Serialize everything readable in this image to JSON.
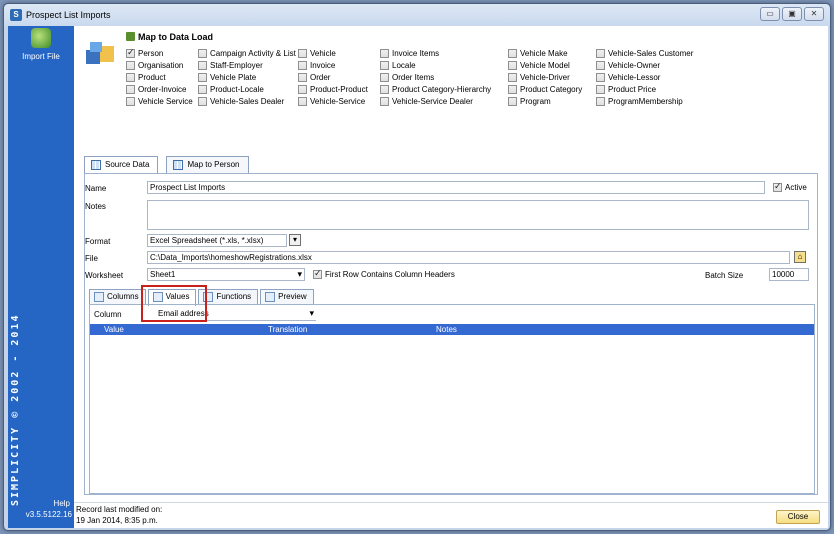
{
  "window": {
    "title": "Prospect List Imports",
    "app_letter": "S"
  },
  "sidebar": {
    "import_label": "Import File",
    "brand": "SIMPLICITY © 2002 - 2014",
    "help": "Help",
    "version": "v3.5.5122.16"
  },
  "map_to_data_load": {
    "heading": "Map to Data Load",
    "entities": [
      {
        "label": "Person",
        "checked": true
      },
      {
        "label": "Organisation",
        "checked": false
      },
      {
        "label": "Product",
        "checked": false
      },
      {
        "label": "Order-Invoice",
        "checked": false
      },
      {
        "label": "Vehicle Service",
        "checked": false
      },
      {
        "label": "Campaign Activity & List",
        "checked": false
      },
      {
        "label": "Staff-Employer",
        "checked": false
      },
      {
        "label": "Vehicle Plate",
        "checked": false
      },
      {
        "label": "Product-Locale",
        "checked": false
      },
      {
        "label": "Vehicle-Sales Dealer",
        "checked": false
      },
      {
        "label": "Vehicle",
        "checked": false
      },
      {
        "label": "Invoice",
        "checked": false
      },
      {
        "label": "Order",
        "checked": false
      },
      {
        "label": "Product-Product",
        "checked": false
      },
      {
        "label": "Vehicle-Service",
        "checked": false
      },
      {
        "label": "Invoice Items",
        "checked": false
      },
      {
        "label": "Locale",
        "checked": false
      },
      {
        "label": "Order Items",
        "checked": false
      },
      {
        "label": "Product Category-Hierarchy",
        "checked": false
      },
      {
        "label": "Vehicle-Service Dealer",
        "checked": false
      },
      {
        "label": "Vehicle Make",
        "checked": false
      },
      {
        "label": "Vehicle Model",
        "checked": false
      },
      {
        "label": "Vehicle-Driver",
        "checked": false
      },
      {
        "label": "Product Category",
        "checked": false
      },
      {
        "label": "Program",
        "checked": false
      },
      {
        "label": "Vehicle-Sales Customer",
        "checked": false
      },
      {
        "label": "Vehicle-Owner",
        "checked": false
      },
      {
        "label": "Vehicle-Lessor",
        "checked": false
      },
      {
        "label": "Product Price",
        "checked": false
      },
      {
        "label": "ProgramMembership",
        "checked": false
      }
    ]
  },
  "tabs": [
    "Source Data",
    "Map to Person"
  ],
  "form": {
    "name_label": "Name",
    "name_value": "Prospect List Imports",
    "active_label": "Active",
    "active_checked": true,
    "notes_label": "Notes",
    "notes_value": "",
    "format_label": "Format",
    "format_value": "Excel Spreadsheet (*.xls, *.xlsx)",
    "file_label": "File",
    "file_value": "C:\\Data_Imports\\homeshowRegistrations.xlsx",
    "worksheet_label": "Worksheet",
    "worksheet_value": "Sheet1",
    "first_row_label": "First Row Contains Column Headers",
    "first_row_checked": true,
    "batch_label": "Batch Size",
    "batch_value": "10000"
  },
  "subtabs": [
    "Columns",
    "Values",
    "Functions",
    "Preview"
  ],
  "values_panel": {
    "column_label": "Column",
    "column_value": "Email address",
    "grid_headers": [
      "Value",
      "Translation",
      "Notes"
    ]
  },
  "status": {
    "line1": "Record last modified on:",
    "line2": "19 Jan 2014, 8:35 p.m.",
    "close_label": "Close"
  },
  "colors": {
    "sidebar": "#2565c4",
    "grid_header": "#3569d2",
    "highlight": "#c9201b"
  }
}
